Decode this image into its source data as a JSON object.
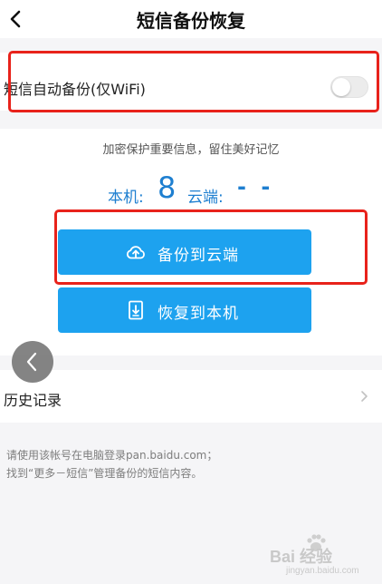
{
  "header": {
    "title": "短信备份恢复",
    "back_icon": "chevron-left-icon"
  },
  "auto_backup": {
    "label": "短信自动备份(仅WiFi)",
    "enabled": false
  },
  "info": {
    "subtitle": "加密保护重要信息，留住美好记忆",
    "local_label": "本机:",
    "local_count": "8",
    "cloud_label": "云端:",
    "cloud_count": "- -"
  },
  "buttons": {
    "backup_label": "备份到云端",
    "backup_icon": "cloud-upload-icon",
    "restore_label": "恢复到本机",
    "restore_icon": "download-to-device-icon",
    "color": "#1da2ef"
  },
  "history": {
    "label": "历史记录",
    "chevron_icon": "chevron-right-icon"
  },
  "notes": {
    "line1": "请使用该帐号在电脑登录pan.baidu.com；",
    "line2": "找到“更多－短信”管理备份的短信内容。"
  },
  "watermark": {
    "text": "Bai 经验",
    "url": "jingyan.baidu.com"
  },
  "annotation_color": "#e8221b"
}
